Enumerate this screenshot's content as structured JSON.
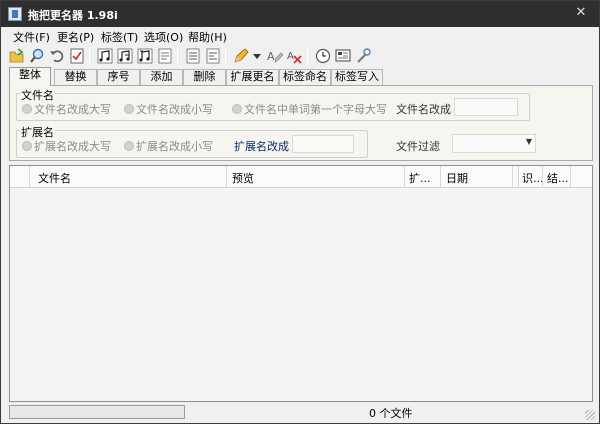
{
  "window": {
    "title": "拖把更名器 1.98i",
    "close_glyph": "✕"
  },
  "menu": [
    {
      "label": "文件(F)"
    },
    {
      "label": "更名(P)"
    },
    {
      "label": "标签(T)"
    },
    {
      "label": "选项(O)"
    },
    {
      "label": "帮助(H)"
    }
  ],
  "toolbar": {
    "buttons": [
      {
        "icon": "open-folder-icon"
      },
      {
        "icon": "search-icon"
      },
      {
        "icon": "undo-icon"
      },
      {
        "icon": "checklist-icon"
      },
      {
        "icon": "music-note-icon"
      },
      {
        "icon": "music-note-edit-icon"
      },
      {
        "icon": "music-note-write-icon"
      },
      {
        "icon": "document-list-icon"
      },
      {
        "icon": "document-icon"
      },
      {
        "icon": "document-edit-icon"
      },
      {
        "icon": "pencil-icon"
      },
      {
        "icon": "dropdown-arrow-icon"
      },
      {
        "icon": "rename-a-icon"
      },
      {
        "icon": "rename-delete-icon"
      },
      {
        "icon": "clock-icon"
      },
      {
        "icon": "screen-icon"
      },
      {
        "icon": "tools-icon"
      }
    ]
  },
  "tabs": [
    {
      "label": "整体",
      "active": true
    },
    {
      "label": "替换"
    },
    {
      "label": "序号"
    },
    {
      "label": "添加"
    },
    {
      "label": "删除"
    },
    {
      "label": "扩展更名"
    },
    {
      "label": "标签命名"
    },
    {
      "label": "标签写入"
    }
  ],
  "filename_group": {
    "label": "文件名",
    "options": [
      {
        "label": "文件名改成大写"
      },
      {
        "label": "文件名改成小写"
      },
      {
        "label": "文件名中单词第一个字母大写"
      }
    ],
    "rename_label": "文件名改成",
    "rename_value": ""
  },
  "extension_group": {
    "label": "扩展名",
    "options": [
      {
        "label": "扩展名改成大写"
      },
      {
        "label": "扩展名改成小写"
      }
    ],
    "rename_label": "扩展名改成",
    "rename_value": ""
  },
  "filter": {
    "label": "文件过滤",
    "value": "",
    "arrow": "▼"
  },
  "list": {
    "columns": [
      {
        "label": ""
      },
      {
        "label": "文件名"
      },
      {
        "label": "预览"
      },
      {
        "label": "扩..."
      },
      {
        "label": "日期"
      },
      {
        "label": ""
      },
      {
        "label": "识..."
      },
      {
        "label": "结..."
      },
      {
        "label": ""
      }
    ]
  },
  "status": {
    "text": "0 个文件",
    "progress": 0
  },
  "colors": {
    "titlebar": "#2f2f2f",
    "rename_ext_label": "#0a2a6a"
  }
}
